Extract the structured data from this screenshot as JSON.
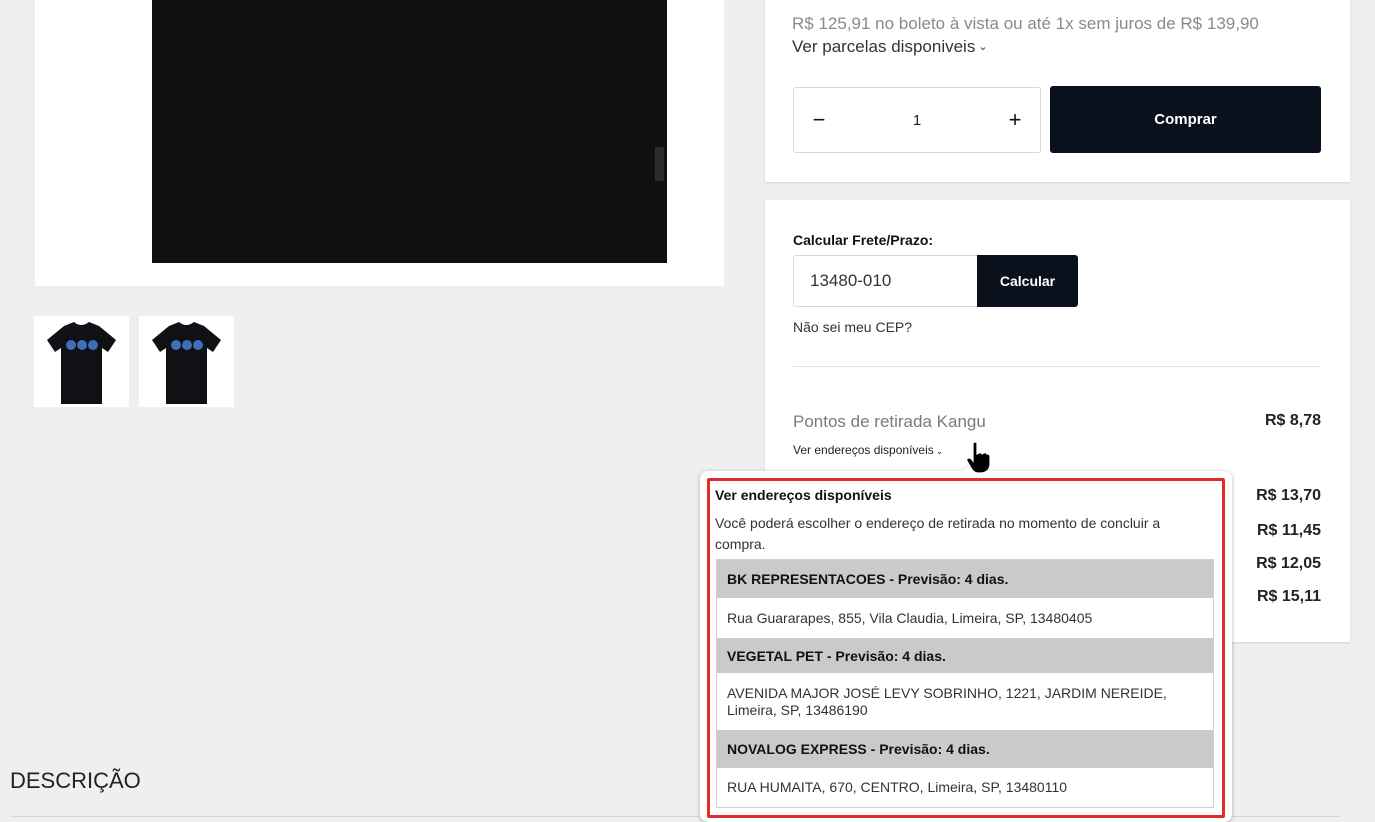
{
  "purchase": {
    "price_line": "R$ 125,91 no boleto à vista ou até 1x sem juros de R$ 139,90",
    "installments_link": "Ver parcelas disponiveis",
    "chevron": "⌄",
    "quantity": "1",
    "minus_label": "−",
    "plus_label": "+",
    "buy_label": "Comprar"
  },
  "shipping": {
    "label": "Calcular Frete/Prazo:",
    "cep_value": "13480-010",
    "calc_label": "Calcular",
    "cep_help": "Não sei meu CEP?",
    "pickup_name": "Pontos de retirada Kangu",
    "pickup_price": "R$ 8,78",
    "addresses_link": "Ver endereços disponíveis",
    "other_prices": [
      "R$ 13,70",
      "R$ 11,45",
      "R$ 12,05",
      "R$ 15,11"
    ]
  },
  "popover": {
    "title": "Ver endereços disponíveis",
    "text": "Você poderá escolher o endereço de retirada no momento de concluir a compra.",
    "addresses": [
      {
        "name": "BK REPRESENTACOES - Previsão: 4 dias.",
        "address": "Rua Guararapes, 855, Vila Claudia, Limeira, SP, 13480405"
      },
      {
        "name": "VEGETAL PET - Previsão: 4 dias.",
        "address": "AVENIDA MAJOR JOSÉ LEVY SOBRINHO, 1221, JARDIM NEREIDE, Limeira, SP, 13486190"
      },
      {
        "name": "NOVALOG EXPRESS - Previsão: 4 dias.",
        "address": "RUA HUMAITA, 670, CENTRO, Limeira, SP, 13480110"
      }
    ]
  },
  "description": {
    "title": "DESCRIÇÃO"
  },
  "icons": {
    "cursor": "hand-pointer-icon",
    "chevron": "chevron-down-icon"
  },
  "colors": {
    "button_dark": "#0a111c",
    "highlight": "#e22b2b",
    "shirt": "#0f1012",
    "page_bg": "#efefef"
  }
}
